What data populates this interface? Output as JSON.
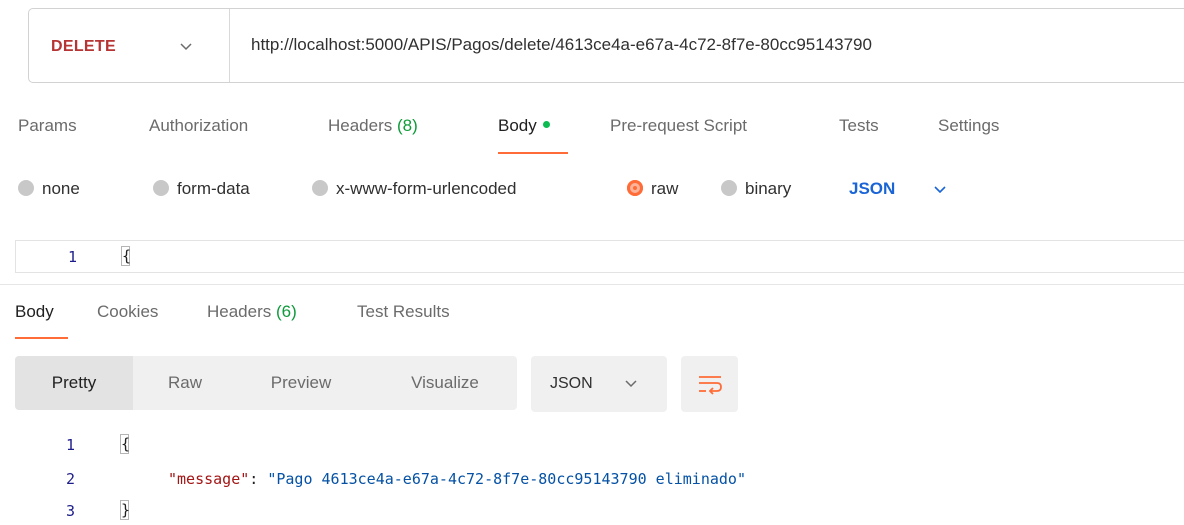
{
  "request": {
    "method": "DELETE",
    "url": "http://localhost:5000/APIS/Pagos/delete/4613ce4a-e67a-4c72-8f7e-80cc95143790"
  },
  "request_tabs": [
    {
      "label": "Params",
      "count": ""
    },
    {
      "label": "Authorization",
      "count": ""
    },
    {
      "label": "Headers",
      "count": "(8)"
    },
    {
      "label": "Body",
      "count": ""
    },
    {
      "label": "Pre-request Script",
      "count": ""
    },
    {
      "label": "Tests",
      "count": ""
    },
    {
      "label": "Settings",
      "count": ""
    }
  ],
  "active_request_tab": "Body",
  "body_types": [
    "none",
    "form-data",
    "x-www-form-urlencoded",
    "raw",
    "binary"
  ],
  "selected_body_type": "raw",
  "body_format": "JSON",
  "request_editor": {
    "line_number": "1",
    "content": "{"
  },
  "response_tabs": [
    {
      "label": "Body",
      "count": ""
    },
    {
      "label": "Cookies",
      "count": ""
    },
    {
      "label": "Headers",
      "count": "(6)"
    },
    {
      "label": "Test Results",
      "count": ""
    }
  ],
  "active_response_tab": "Body",
  "view_modes": [
    "Pretty",
    "Raw",
    "Preview",
    "Visualize"
  ],
  "active_view_mode": "Pretty",
  "response_format": "JSON",
  "response_body": {
    "lines": [
      {
        "num": "1",
        "open": "{"
      },
      {
        "num": "2",
        "key": "\"message\"",
        "colon": ": ",
        "value": "\"Pago 4613ce4a-e67a-4c72-8f7e-80cc95143790 eliminado\""
      },
      {
        "num": "3",
        "close": "}"
      }
    ]
  },
  "colors": {
    "method_delete": "#b73434",
    "accent": "#ff6c37",
    "count_green": "#0e9b3a",
    "body_dot": "#0cbb52",
    "json_blue": "#1a64d6",
    "json_key": "#a31515",
    "json_string": "#0451a5"
  },
  "icons": {
    "method_chevron": "chevron-down-icon",
    "format_chevron": "chevron-down-icon",
    "wrap": "wrap-lines-icon"
  }
}
